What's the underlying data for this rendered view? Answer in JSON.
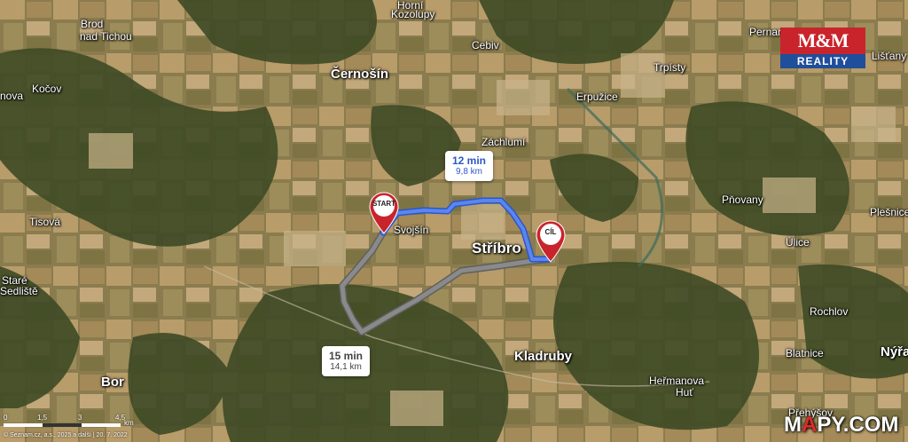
{
  "map": {
    "places": [
      {
        "id": "brod",
        "text": "Brod",
        "kind": "village"
      },
      {
        "id": "nad-tichou",
        "text": "nad Tichou",
        "kind": "village"
      },
      {
        "id": "horni",
        "text": "Horní",
        "kind": "village"
      },
      {
        "id": "kozolupy",
        "text": "Kozolupy",
        "kind": "village"
      },
      {
        "id": "cernosin",
        "text": "Černošín",
        "kind": "town"
      },
      {
        "id": "cebiv",
        "text": "Cebiv",
        "kind": "village"
      },
      {
        "id": "pernarec",
        "text": "Pernare",
        "kind": "village"
      },
      {
        "id": "listany",
        "text": "Lišťany",
        "kind": "village"
      },
      {
        "id": "trpisty",
        "text": "Trpísty",
        "kind": "village"
      },
      {
        "id": "erpuzice",
        "text": "Erpužice",
        "kind": "village"
      },
      {
        "id": "kocov",
        "text": "Kočov",
        "kind": "village"
      },
      {
        "id": "nova",
        "text": "nova",
        "kind": "village"
      },
      {
        "id": "zachlumi",
        "text": "Záchlumí",
        "kind": "village"
      },
      {
        "id": "pnovany",
        "text": "Pňovany",
        "kind": "village"
      },
      {
        "id": "tisova",
        "text": "Tisová",
        "kind": "village"
      },
      {
        "id": "svojsin",
        "text": "Svojšín",
        "kind": "village"
      },
      {
        "id": "stribro",
        "text": "Stříbro",
        "kind": "city"
      },
      {
        "id": "plesnice",
        "text": "Plešnice",
        "kind": "village"
      },
      {
        "id": "ulice",
        "text": "Úlice",
        "kind": "village"
      },
      {
        "id": "stare",
        "text": "Staré",
        "kind": "village"
      },
      {
        "id": "sedliste",
        "text": "Sedliště",
        "kind": "village"
      },
      {
        "id": "rochlov",
        "text": "Rochlov",
        "kind": "village"
      },
      {
        "id": "kladruby",
        "text": "Kladruby",
        "kind": "town"
      },
      {
        "id": "blatnice",
        "text": "Blatnice",
        "kind": "village"
      },
      {
        "id": "nyrany",
        "text": "Nýřa",
        "kind": "town"
      },
      {
        "id": "bor",
        "text": "Bor",
        "kind": "town"
      },
      {
        "id": "hermanova",
        "text": "Heřmanova",
        "kind": "village"
      },
      {
        "id": "hut",
        "text": "Huť",
        "kind": "village"
      },
      {
        "id": "prehysov",
        "text": "Přehýšov",
        "kind": "village"
      }
    ],
    "markers": {
      "start": {
        "label": "START"
      },
      "end": {
        "label": "CÍL"
      }
    },
    "routes": [
      {
        "id": "route-main",
        "time": "12 min",
        "distance": "9,8 km",
        "active": true,
        "color": "#4a78e6"
      },
      {
        "id": "route-alt",
        "time": "15 min",
        "distance": "14,1 km",
        "active": false,
        "color": "#8a8a8a"
      }
    ],
    "scale": {
      "ticks": [
        "0",
        "1,5",
        "3",
        "4,5"
      ],
      "unit": "km"
    },
    "copyright": "© Seznam.cz, a.s., 2025 a další | 20. 7. 2022"
  },
  "logo": {
    "top": "M&M",
    "bottom": "REALITY"
  },
  "brand": {
    "prefix": "M",
    "accent": "A",
    "suffix": "PY.COM"
  },
  "colors": {
    "start_pin": "#c9242b",
    "end_pin": "#c9242b",
    "logo_red": "#c9242b",
    "logo_blue": "#1f4e9a"
  }
}
